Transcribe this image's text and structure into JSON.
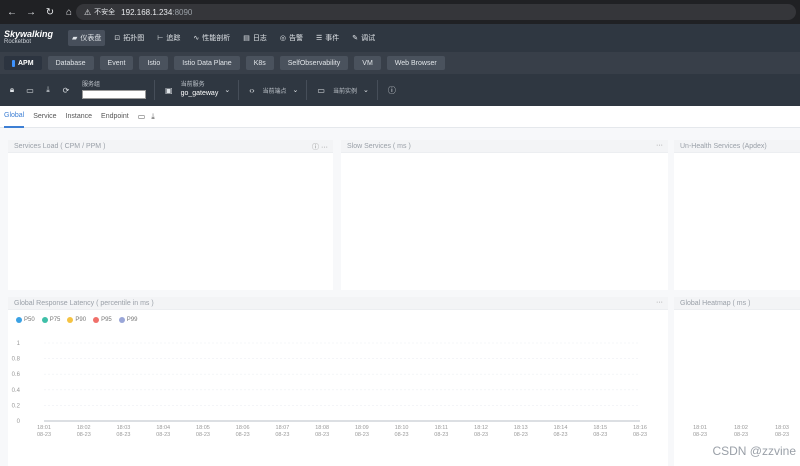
{
  "browser": {
    "insecure_label": "不安全",
    "host": "192.168.1.234",
    "port": ":8090"
  },
  "app": {
    "logo_line1": "Skywalking",
    "logo_line2": "Rocketbot",
    "nav": [
      {
        "label": "仪表盘",
        "icon": "dashboard-icon"
      },
      {
        "label": "拓扑图",
        "icon": "topology-icon"
      },
      {
        "label": "追踪",
        "icon": "trace-icon"
      },
      {
        "label": "性能剖析",
        "icon": "profile-icon"
      },
      {
        "label": "日志",
        "icon": "log-icon"
      },
      {
        "label": "告警",
        "icon": "alarm-icon"
      },
      {
        "label": "事件",
        "icon": "event-icon"
      },
      {
        "label": "调试",
        "icon": "debug-icon"
      }
    ]
  },
  "layers": [
    "APM",
    "Database",
    "Event",
    "Istio",
    "Istio Data Plane",
    "K8s",
    "SelfObservability",
    "VM",
    "Web Browser"
  ],
  "toolbar": {
    "group_label": "服务组",
    "service_label": "当前服务",
    "service_value": "go_gateway",
    "endpoint_label": "当前端点",
    "instance_label": "当前实例"
  },
  "dash_tabs": [
    "Global",
    "Service",
    "Instance",
    "Endpoint"
  ],
  "panels": {
    "services_load": "Services Load ( CPM / PPM )",
    "slow_services": "Slow Services ( ms )",
    "unhealth_services": "Un-Health Services (Apdex)",
    "global_latency": "Global Response Latency ( percentile in ms )",
    "global_heatmap": "Global Heatmap ( ms )"
  },
  "colors": {
    "accent": "#3d7fd4",
    "header_bg": "#2f3741"
  },
  "chart_data": [
    {
      "type": "line",
      "title": "Global Response Latency ( percentile in ms )",
      "legend": [
        "P50",
        "P75",
        "P90",
        "P95",
        "P99"
      ],
      "legend_colors": [
        "#3ba1e4",
        "#3fbfa8",
        "#f5c342",
        "#f0706a",
        "#9aa6d8"
      ],
      "legend_placement": "top-left",
      "ylim": [
        0,
        1
      ],
      "yticks": [
        "1",
        "0.8",
        "0.6",
        "0.4",
        "0.2",
        "0"
      ],
      "x_time": [
        "18:01",
        "18:02",
        "18:03",
        "18:04",
        "18:05",
        "18:06",
        "18:07",
        "18:08",
        "18:09",
        "18:10",
        "18:11",
        "18:12",
        "18:13",
        "18:14",
        "18:15",
        "18:16"
      ],
      "x_date": "08-23",
      "grid": true,
      "series": []
    },
    {
      "type": "heatmap",
      "title": "Global Heatmap ( ms )",
      "x_time": [
        "18:01",
        "18:02",
        "18:03"
      ],
      "x_date": "08-23"
    }
  ],
  "watermark": "CSDN @zzvine"
}
